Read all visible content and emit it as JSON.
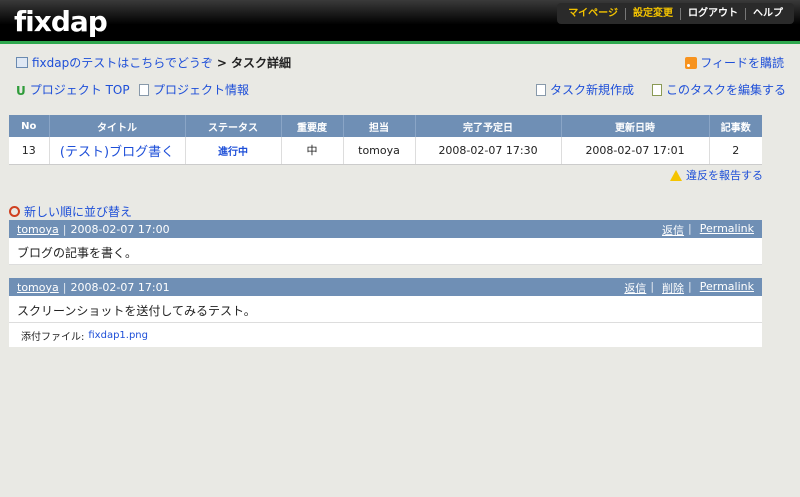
{
  "header": {
    "logo": "fixdap",
    "nav": [
      "マイページ",
      "設定変更",
      "ログアウト",
      "ヘルプ"
    ]
  },
  "breadcrumb": {
    "project": "fixdapのテストはこちらでどうぞ",
    "separator": ">",
    "current": "タスク詳細"
  },
  "feed": {
    "label": "フィードを購読"
  },
  "actions": {
    "project_top": "プロジェクト TOP",
    "project_info": "プロジェクト情報",
    "new_task": "タスク新規作成",
    "edit_task": "このタスクを編集する"
  },
  "table": {
    "headers": [
      "No",
      "タイトル",
      "ステータス",
      "重要度",
      "担当",
      "完了予定日",
      "更新日時",
      "記事数"
    ],
    "row": {
      "no": "13",
      "title": "(テスト)ブログ書く",
      "status": "進行中",
      "priority": "中",
      "assignee": "tomoya",
      "due": "2008-02-07 17:30",
      "updated": "2008-02-07 17:01",
      "count": "2"
    }
  },
  "report": {
    "label": "違反を報告する"
  },
  "sort": {
    "label": "新しい順に並び替え"
  },
  "comments": [
    {
      "user": "tomoya",
      "date": "2008-02-07 17:00",
      "links": [
        "返信",
        "Permalink"
      ],
      "body": "ブログの記事を書く。"
    },
    {
      "user": "tomoya",
      "date": "2008-02-07 17:01",
      "links": [
        "返信",
        "削除",
        "Permalink"
      ],
      "body": "スクリーンショットを送付してみるテスト。",
      "attachment_label": "添付ファイル:",
      "attachment_file": "fixdap1.png"
    }
  ]
}
